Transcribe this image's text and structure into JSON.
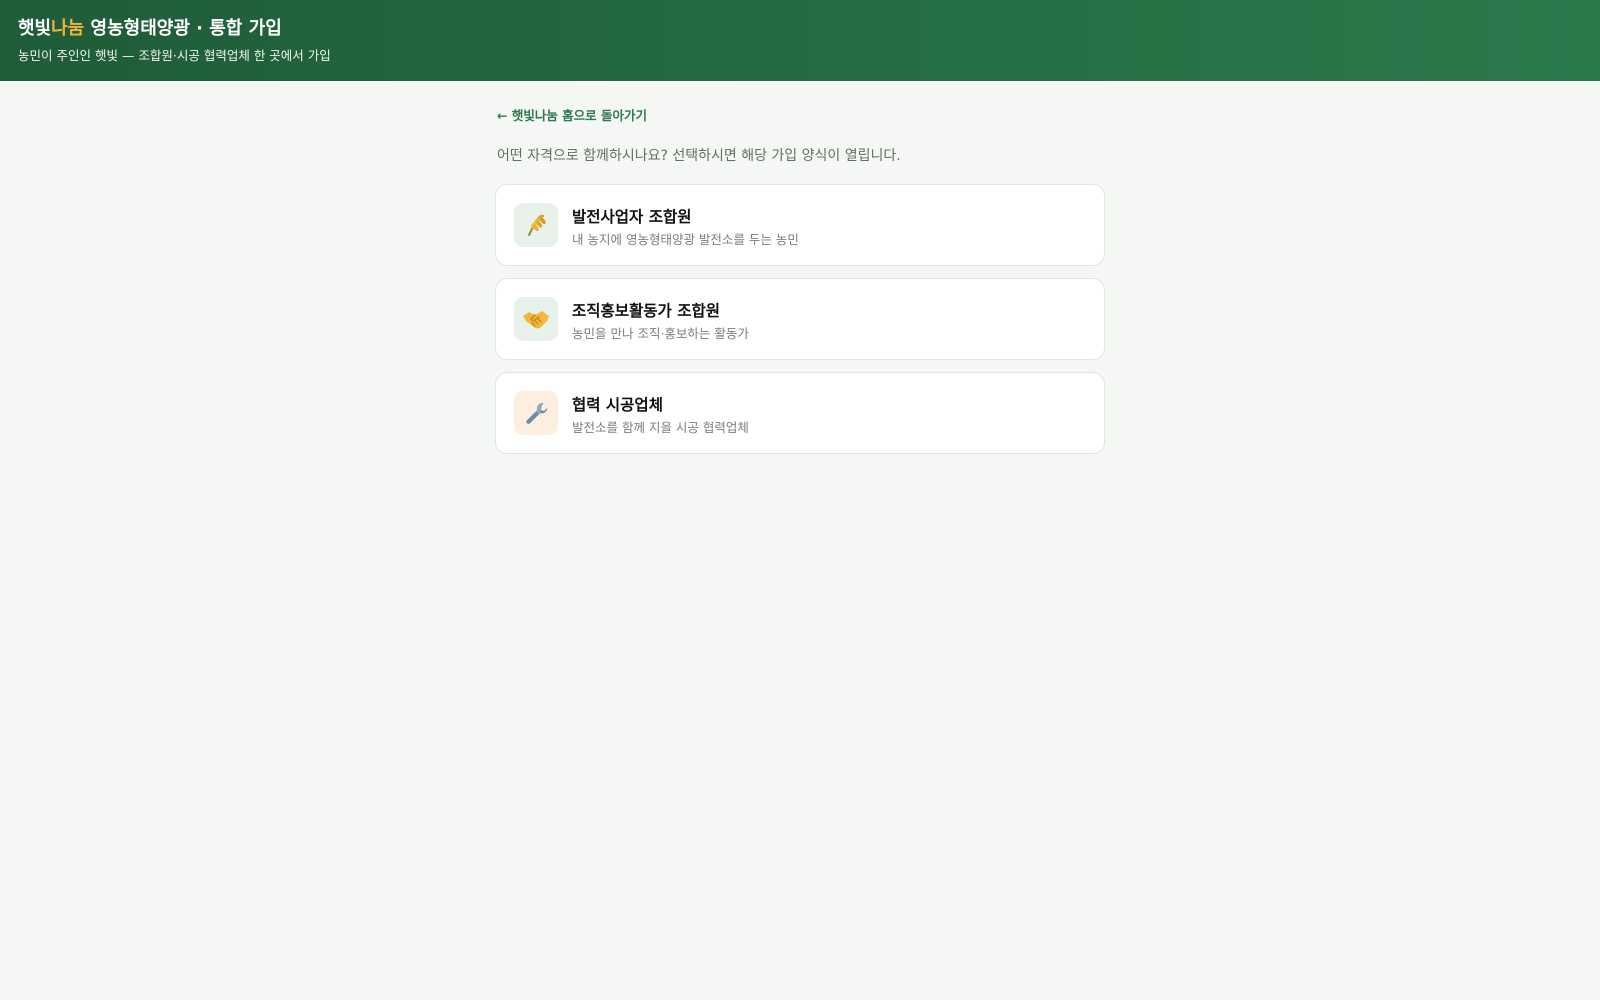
{
  "header": {
    "brand_part1": "햇빛",
    "brand_accent": "나눔",
    "brand_rest": " 영농형태양광 · 통합 가입",
    "tagline": "농민이 주인인 햇빛 — 조합원·시공 협력업체 한 곳에서 가입",
    "accent_color": "#f2b33d",
    "background_color": "#2b7a4c"
  },
  "main": {
    "back_link": "← 햇빛나눔 홈으로 돌아가기",
    "intro": "어떤 자격으로 함께하시나요? 선택하시면 해당 가입 양식이 열립니다.",
    "options": [
      {
        "icon": "wheat-icon",
        "title": "발전사업자 조합원",
        "description": "내 농지에 영농형태양광 발전소를 두는 농민"
      },
      {
        "icon": "handshake-icon",
        "title": "조직홍보활동가 조합원",
        "description": "농민을 만나 조직·홍보하는 활동가"
      },
      {
        "icon": "wrench-icon",
        "title": "협력 시공업체",
        "description": "발전소를 함께 지을 시공 협력업체"
      }
    ]
  }
}
